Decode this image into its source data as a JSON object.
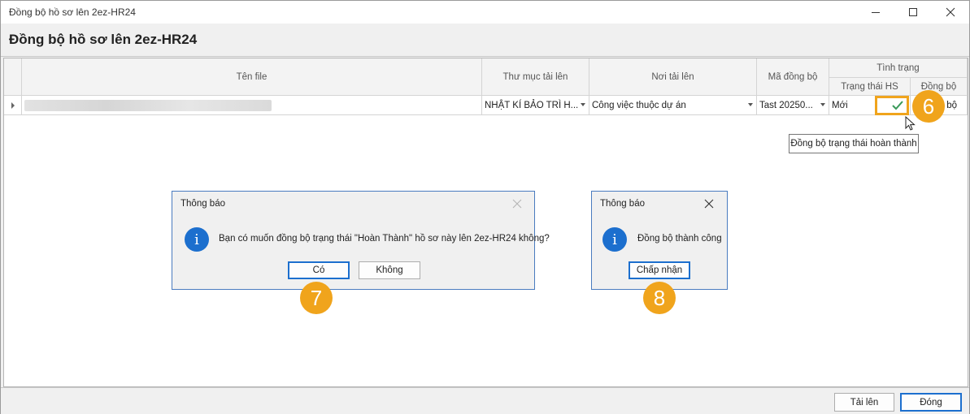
{
  "window": {
    "title": "Đồng bộ hồ sơ lên 2ez-HR24",
    "controls": {
      "minimize": "minimize-icon",
      "maximize": "maximize-icon",
      "close": "close-icon"
    }
  },
  "header": {
    "title": "Đồng bộ hồ sơ lên 2ez-HR24"
  },
  "grid": {
    "columns": {
      "ten_file": "Tên file",
      "thu_muc": "Thư mục tải lên",
      "noi_tai_len": "Nơi tải lên",
      "ma_dong_bo": "Mã đồng bộ",
      "tinh_trang": "Tình trạng",
      "trang_thai_hs": "Trạng thái HS",
      "dong_bo": "Đồng bộ"
    },
    "rows": [
      {
        "ten_file": "",
        "thu_muc": "NHẬT KÍ BẢO TRÌ H...",
        "noi_tai_len": "Công việc thuộc dự án",
        "ma_dong_bo": "Tast 20250...",
        "trang_thai_hs": "Mới",
        "dong_bo": "bộ"
      }
    ]
  },
  "tooltip": "Đồng bộ trạng thái hoàn thành",
  "badges": {
    "b6": "6",
    "b7": "7",
    "b8": "8"
  },
  "confirm_dialog": {
    "title": "Thông báo",
    "message": "Bạn có muốn đồng bộ trạng thái \"Hoàn Thành\" hồ sơ này lên 2ez-HR24 không?",
    "yes": "Có",
    "no": "Không",
    "icon": "i"
  },
  "success_dialog": {
    "title": "Thông báo",
    "message": "Đồng bộ thành công",
    "ok": "Chấp nhận",
    "icon": "i"
  },
  "footer": {
    "upload": "Tải lên",
    "close": "Đóng"
  },
  "colors": {
    "accent": "#1c6fce",
    "highlight": "#f0a41c",
    "check": "#3a9a5a"
  }
}
